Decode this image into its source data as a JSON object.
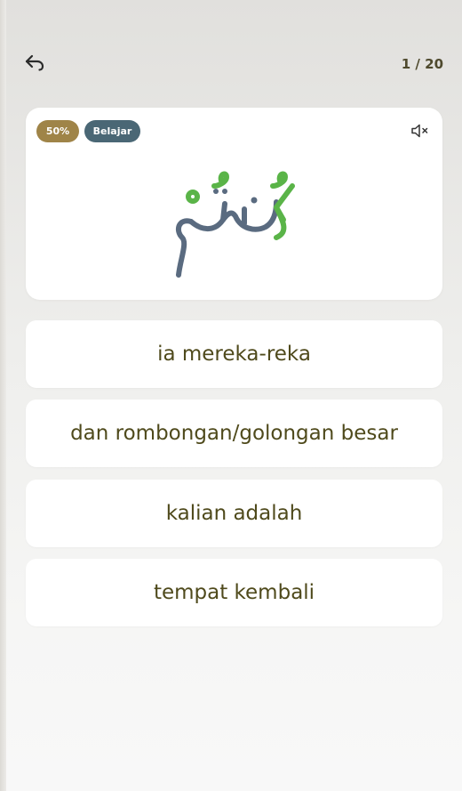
{
  "header": {
    "back_icon": "undo-arrow-icon",
    "progress": "1 / 20"
  },
  "card": {
    "percent_badge": "50%",
    "mode_badge": "Belajar",
    "mute_icon": "speaker-muted-icon",
    "arabic_word": "كُنتُم",
    "colors": {
      "harakat": "#5ab448",
      "letters": "#5a6b80"
    }
  },
  "options": [
    "ia mereka-reka",
    "dan rombongan/golongan besar",
    "kalian adalah",
    "tempat kembali"
  ],
  "colors": {
    "percent_badge": "#9f8448",
    "mode_badge": "#4a6775",
    "option_text": "#4f4a1c"
  }
}
